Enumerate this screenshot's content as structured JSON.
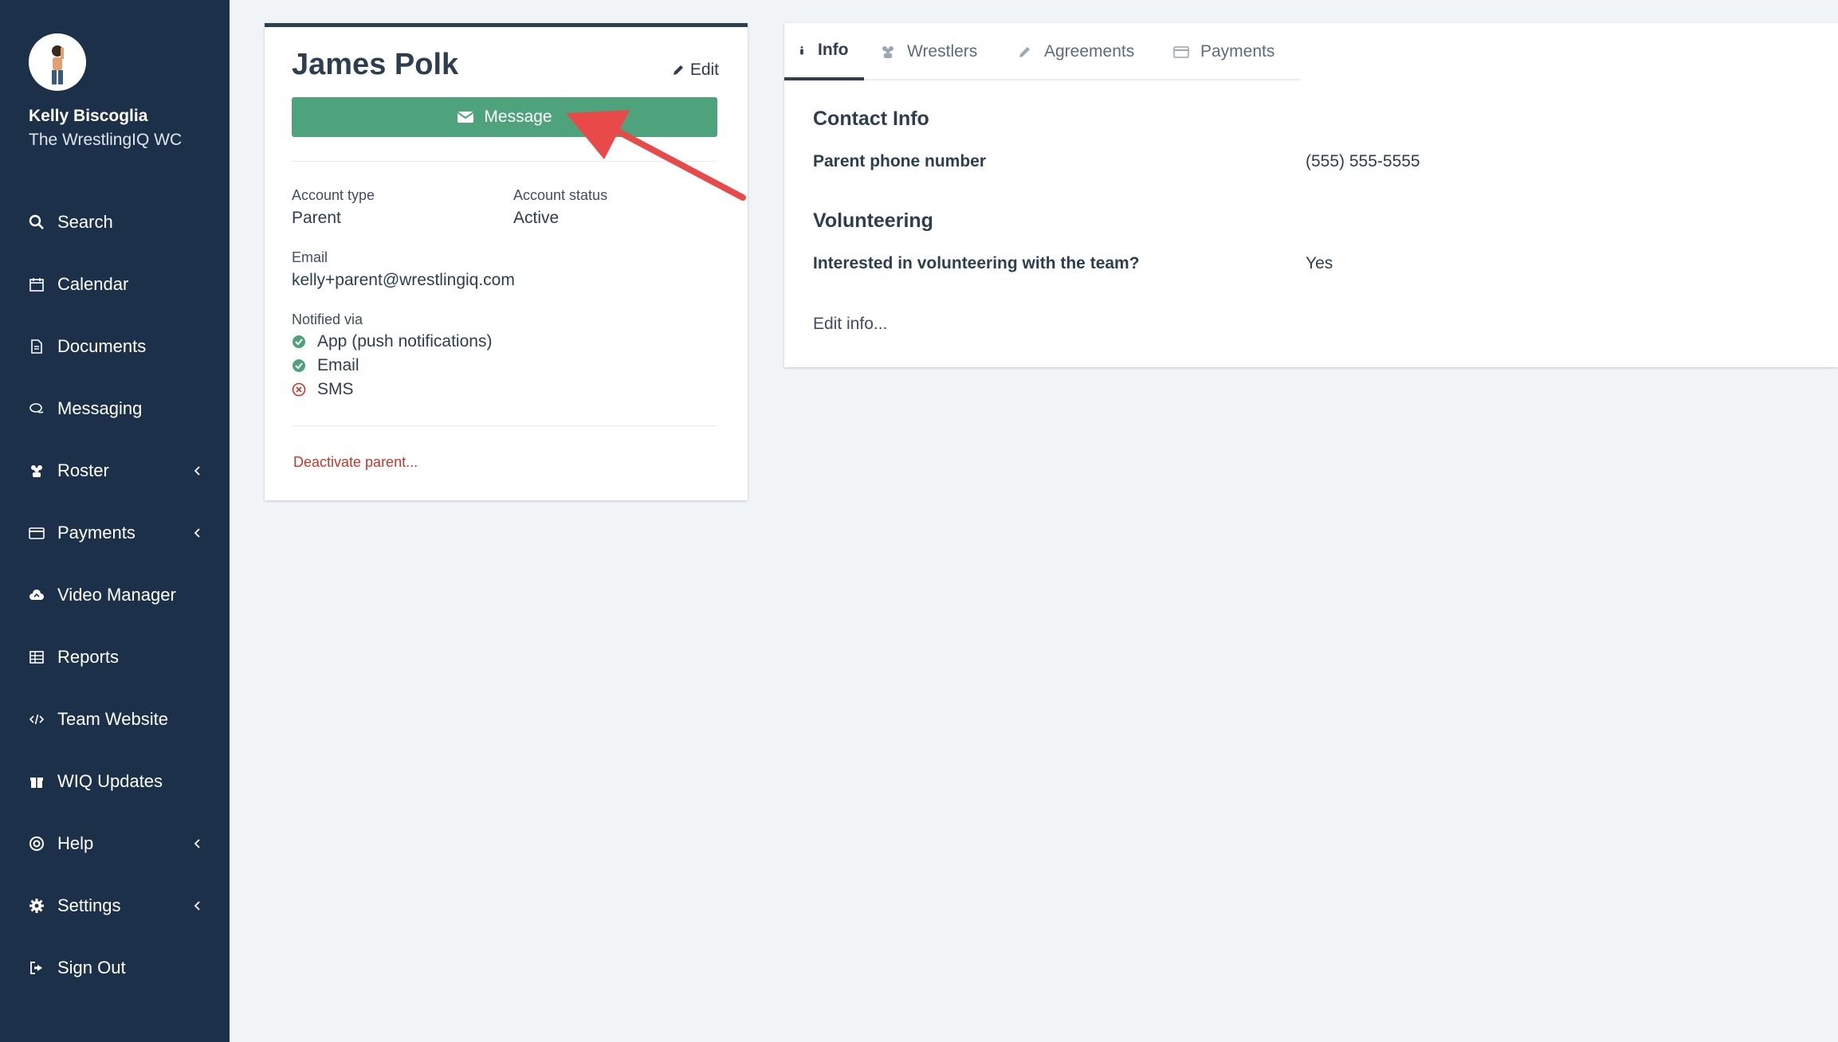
{
  "sidebar": {
    "user_name": "Kelly Biscoglia",
    "team_name": "The WrestlingIQ WC",
    "items": [
      {
        "label": "Search",
        "icon": "search-icon"
      },
      {
        "label": "Calendar",
        "icon": "calendar-icon"
      },
      {
        "label": "Documents",
        "icon": "document-icon"
      },
      {
        "label": "Messaging",
        "icon": "chat-icon"
      },
      {
        "label": "Roster",
        "icon": "users-icon"
      },
      {
        "label": "Payments",
        "icon": "credit-card-icon"
      },
      {
        "label": "Video Manager",
        "icon": "cloud-upload-icon"
      },
      {
        "label": "Reports",
        "icon": "table-icon"
      },
      {
        "label": "Team Website",
        "icon": "code-icon"
      },
      {
        "label": "WIQ Updates",
        "icon": "gift-icon"
      },
      {
        "label": "Help",
        "icon": "lifebuoy-icon"
      },
      {
        "label": "Settings",
        "icon": "gear-icon"
      },
      {
        "label": "Sign Out",
        "icon": "sign-out-icon"
      }
    ]
  },
  "profile": {
    "name": "James Polk",
    "edit_label": "Edit",
    "message_label": "Message",
    "account_type_label": "Account type",
    "account_type_value": "Parent",
    "account_status_label": "Account status",
    "account_status_value": "Active",
    "email_label": "Email",
    "email_value": "kelly+parent@wrestlingiq.com",
    "notified_label": "Notified via",
    "notifications": [
      {
        "label": "App (push notifications)",
        "enabled": true
      },
      {
        "label": "Email",
        "enabled": true
      },
      {
        "label": "SMS",
        "enabled": false
      }
    ],
    "deactivate_label": "Deactivate parent..."
  },
  "tabs": [
    {
      "label": "Info",
      "icon": "info-icon",
      "active": true
    },
    {
      "label": "Wrestlers",
      "icon": "users-icon",
      "active": false
    },
    {
      "label": "Agreements",
      "icon": "pencil-icon",
      "active": false
    },
    {
      "label": "Payments",
      "icon": "credit-card-icon",
      "active": false
    }
  ],
  "info": {
    "contact_title": "Contact Info",
    "phone_label": "Parent phone number",
    "phone_value": "(555) 555-5555",
    "volunteer_title": "Volunteering",
    "volunteer_label": "Interested in volunteering with the team?",
    "volunteer_value": "Yes",
    "edit_info_label": "Edit info..."
  },
  "colors": {
    "sidebar_bg": "#1c3149",
    "accent_green": "#4ea37d",
    "danger_red": "#c0392b",
    "arrow_red": "#e84a4a"
  }
}
